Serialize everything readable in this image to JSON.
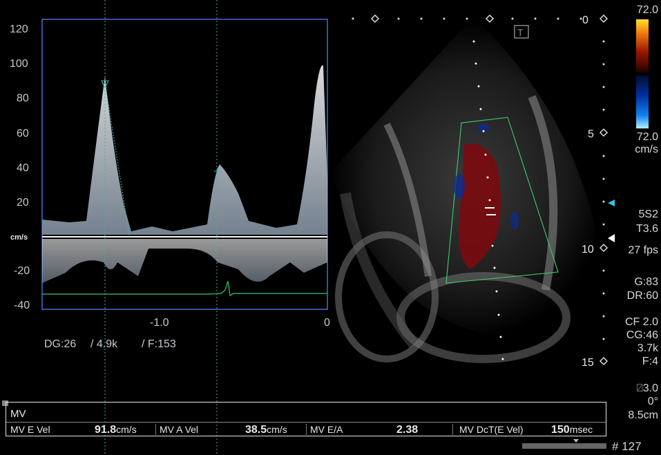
{
  "spectral": {
    "y_ticks": [
      "120",
      "100",
      "80",
      "60",
      "40",
      "20",
      "cm/s",
      "-20",
      "-40"
    ],
    "x_ticks": [
      "-1.0",
      "0"
    ],
    "settings": {
      "dg": "DG:26",
      "prf": "/ 4.9k",
      "frame": "/ F:153"
    }
  },
  "depth_scale": {
    "d0": "0",
    "d5": "5",
    "d10": "10",
    "d15": "15"
  },
  "color_bar": {
    "top": "72.0",
    "bottom": "72.0",
    "unit": "cm/s",
    "colors": [
      "#ffe22a",
      "#f08010",
      "#9a1500",
      "#2a0400",
      "#000000",
      "#001038",
      "#0030a0",
      "#1080f0",
      "#b0f0ff"
    ]
  },
  "params": {
    "probe": "5S2",
    "preset": "T3.6",
    "fps": "27 fps",
    "gain": "G:83",
    "dr": "DR:60",
    "cf": "CF 2.0",
    "cg": "CG:46",
    "cprf": "3.7k",
    "cfilter": "F:4",
    "angle_corr": "3.0",
    "angle": "0°",
    "depth": "8.5cm"
  },
  "measurements": {
    "title": "MV",
    "e_label": "MV E Vel",
    "e_value": "91.8",
    "e_unit": "cm/s",
    "a_label": "MV A Vel",
    "a_value": "38.5",
    "a_unit": "cm/s",
    "ea_label": "MV E/A",
    "ea_value": "2.38",
    "dct_label": "MV DcT(E Vel)",
    "dct_value": "150",
    "dct_unit": "msec"
  },
  "frame_counter": "# 127",
  "t_marker": "T"
}
